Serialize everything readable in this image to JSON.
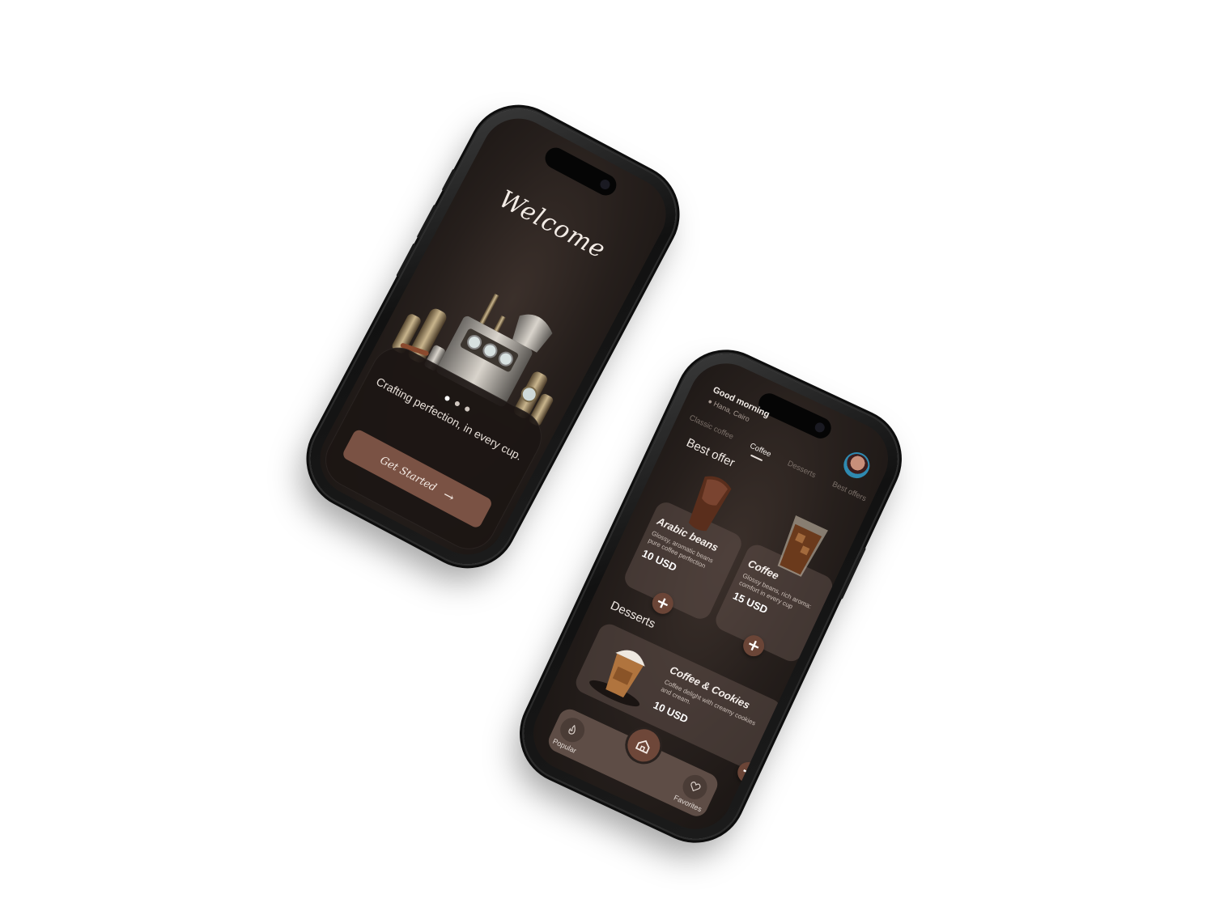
{
  "welcome": {
    "title": "Welcome",
    "tagline": "Crafting perfection, in every cup.",
    "cta": "Get Started",
    "pager_dots": 3
  },
  "menu": {
    "greeting": "Good morning",
    "location": "Hana, Cairo",
    "tabs": [
      {
        "label": "Classic coffee"
      },
      {
        "label": "Coffee"
      },
      {
        "label": "Desserts"
      },
      {
        "label": "Best offers"
      }
    ],
    "active_tab": "Coffee",
    "best_offer_title": "Best offer",
    "products": [
      {
        "name": "Arabic beans",
        "desc": "Glossy, aromatic beans pure coffee perfection",
        "price": "10 USD"
      },
      {
        "name": "Coffee",
        "desc": "Glossy beans, rich aroma: comfort in every cup",
        "price": "15 USD"
      }
    ],
    "desserts_title": "Desserts",
    "dessert": {
      "name": "Coffee & Cookies",
      "desc": "Coffee delight with creamy cookies and cream.",
      "price": "10 USD"
    },
    "nav": {
      "popular": "Popular",
      "favorites": "Favorites"
    }
  },
  "colors": {
    "accent": "#7a5244",
    "bg_dark": "#261f1c",
    "card": "#5e4e48"
  },
  "icons": [
    "location-icon",
    "plus-icon",
    "home-icon",
    "flame-icon",
    "heart-icon"
  ]
}
